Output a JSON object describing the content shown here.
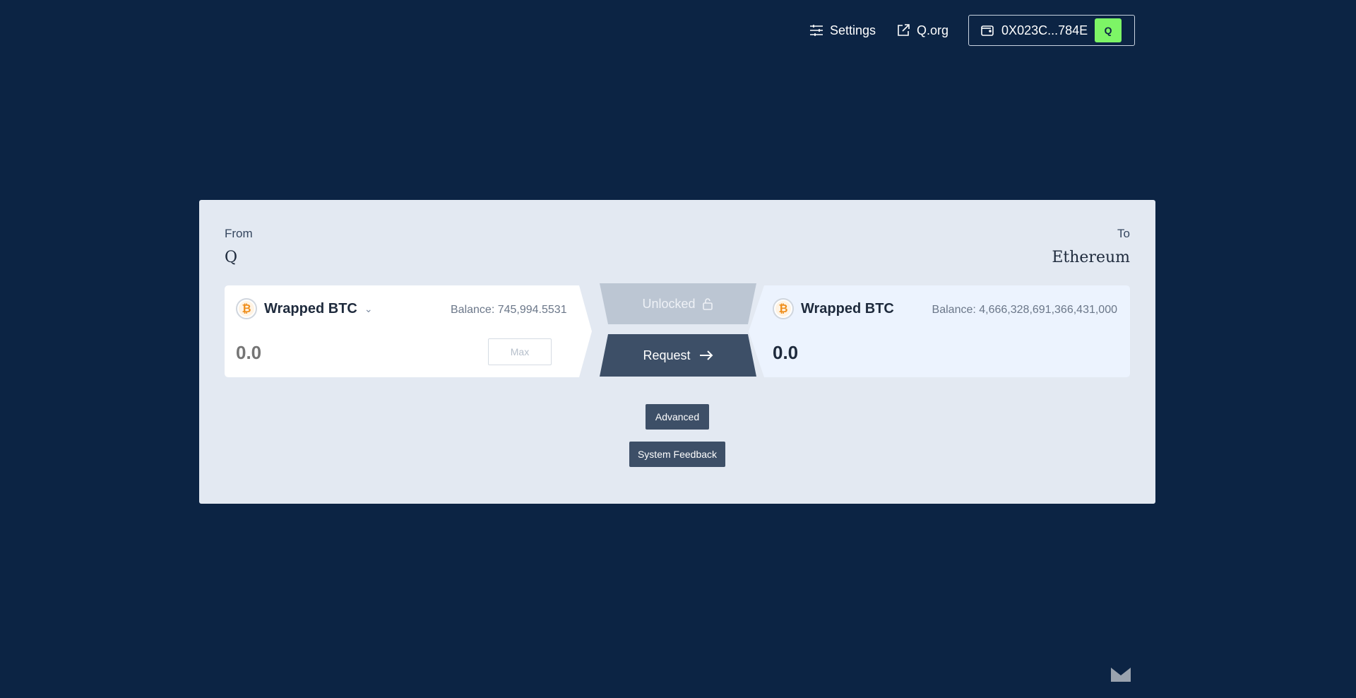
{
  "topbar": {
    "settings_label": "Settings",
    "qorg_label": "Q.org",
    "wallet_address": "0X023C...784E",
    "wallet_badge": "Q"
  },
  "bridge": {
    "from_label": "From",
    "from_network": "Q",
    "to_label": "To",
    "to_network": "Ethereum",
    "source": {
      "token_name": "Wrapped BTC",
      "token_symbol_glyph": "₿",
      "balance": "Balance: 745,994.5531",
      "amount_placeholder": "0.0",
      "max_label": "Max"
    },
    "destination": {
      "token_name": "Wrapped BTC",
      "token_symbol_glyph": "₿",
      "balance": "Balance: 4,666,328,691,366,431,000",
      "amount": "0.0"
    },
    "unlocked_label": "Unlocked",
    "request_label": "Request",
    "advanced_label": "Advanced",
    "feedback_label": "System Feedback"
  },
  "colors": {
    "background": "#0c2444",
    "card": "#e3e9f2",
    "accent_green": "#7df566",
    "button_dark": "#3d4f67"
  },
  "icons": {
    "settings": "sliders-icon",
    "qorg": "external-link-icon",
    "wallet": "wallet-icon",
    "token": "bitcoin-icon",
    "unlocked": "unlock-icon",
    "request": "arrow-right-icon",
    "corner": "mail-icon"
  }
}
